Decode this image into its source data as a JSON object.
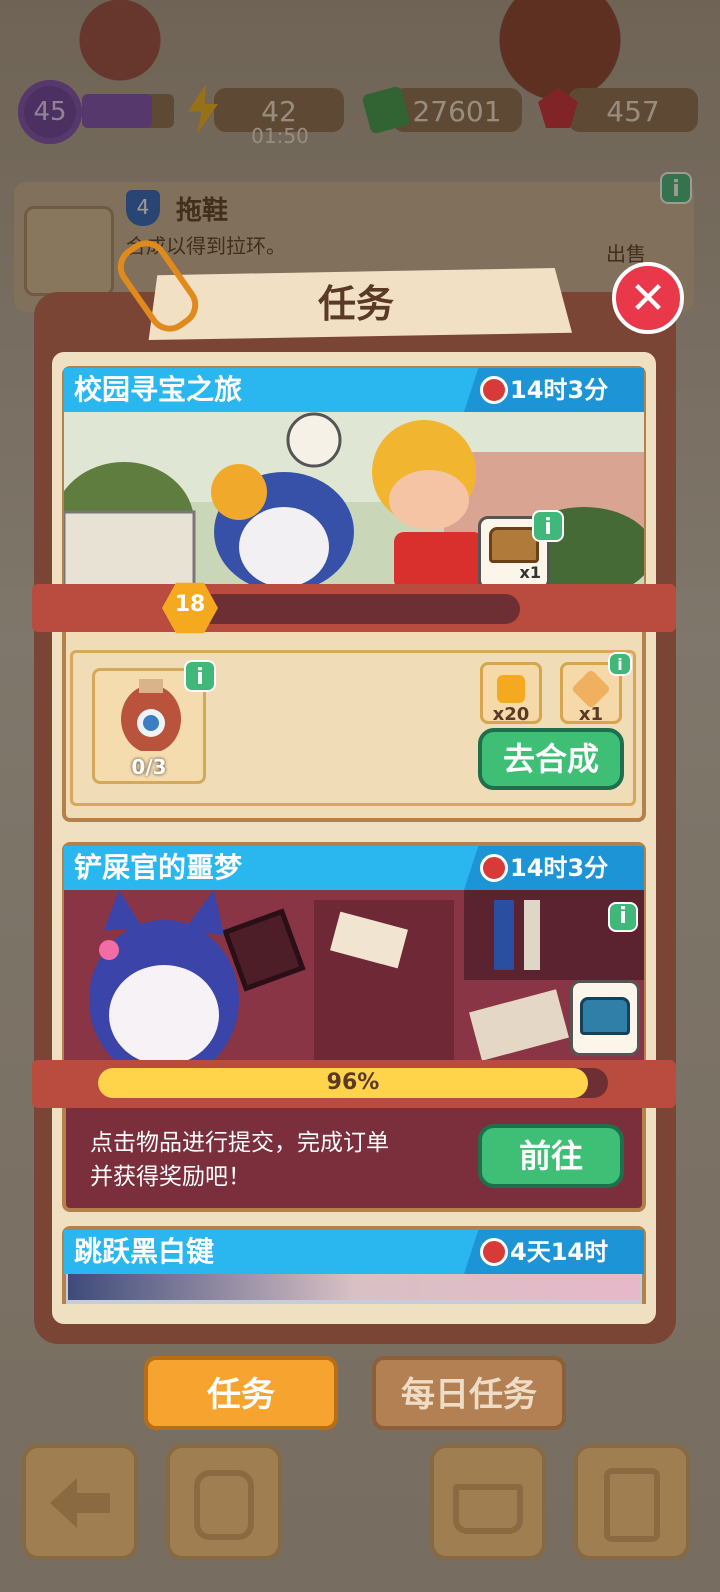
{
  "hud": {
    "level": "45",
    "energy": "42",
    "energy_timer": "01:50",
    "cash": "27601",
    "gems": "457"
  },
  "item_info": {
    "badge": "4",
    "name": "拖鞋",
    "desc": "合成以得到拉环。",
    "sell": "出售"
  },
  "modal": {
    "title": "任务"
  },
  "quests": [
    {
      "title": "校园寻宝之旅",
      "timer": "14时3分",
      "reward_qty": "x1",
      "level": "18",
      "requirement_count": "0/3",
      "bonus": [
        {
          "qty": "x20"
        },
        {
          "qty": "x1"
        }
      ],
      "button": "去合成"
    },
    {
      "title": "铲屎官的噩梦",
      "timer": "14时3分",
      "progress": 0.96,
      "progress_label": "96%",
      "hint": "点击物品进行提交，完成订单并获得奖励吧！",
      "button": "前往"
    },
    {
      "title": "跳跃黑白键",
      "timer": "4天14时"
    }
  ],
  "tabs": [
    {
      "label": "任务",
      "active": true
    },
    {
      "label": "每日任务",
      "active": false
    }
  ],
  "icons": {
    "close": "close-icon",
    "info": "info-icon",
    "clock": "clock-icon",
    "chest": "chest-icon"
  },
  "colors": {
    "accent_blue": "#2ab6ee",
    "green_button": "#3fbf76",
    "close_red": "#e8384a",
    "tab_active": "#f7a330",
    "progress_yellow": "#ffd34a"
  }
}
